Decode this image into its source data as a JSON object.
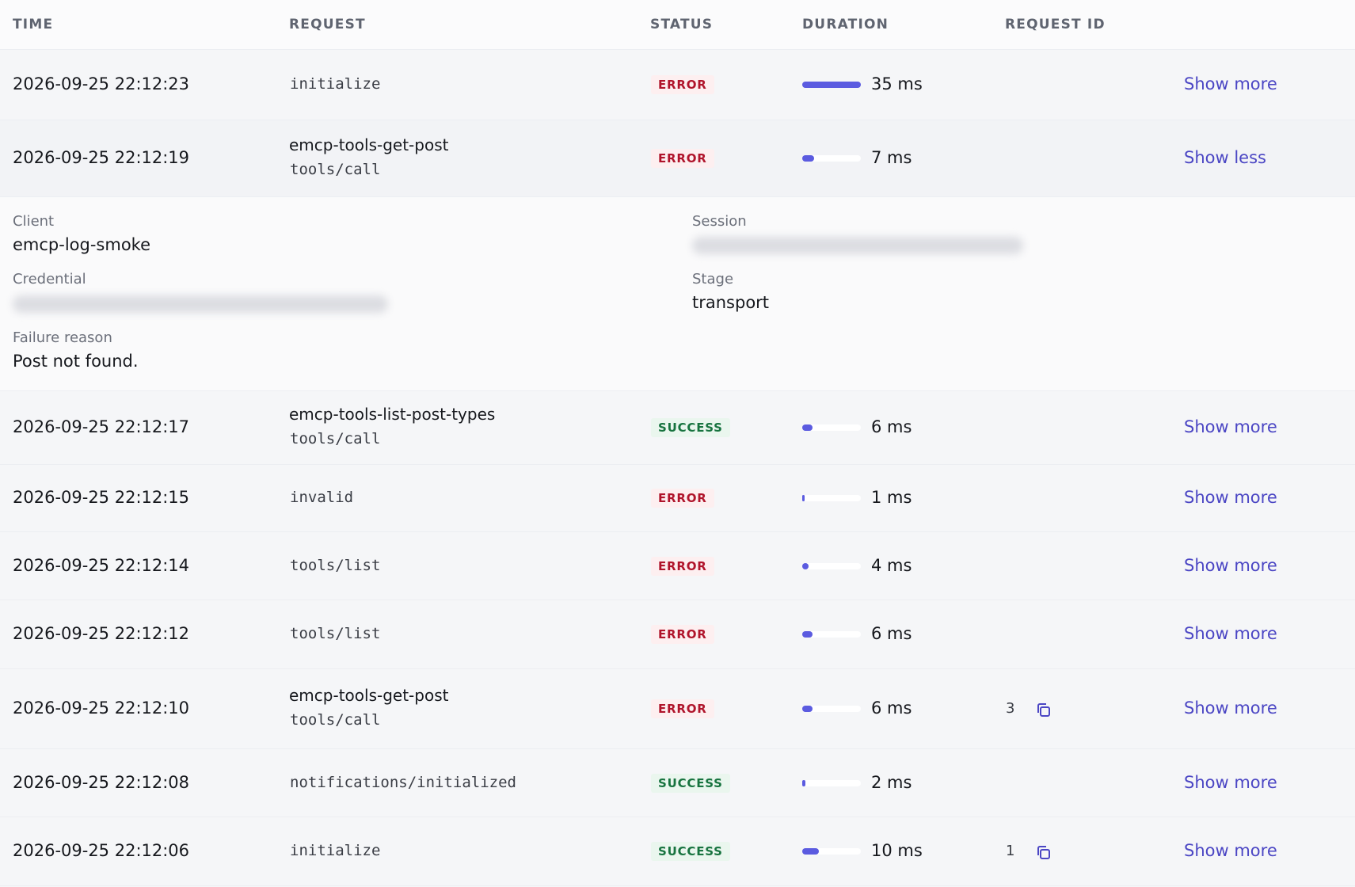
{
  "columns": {
    "time": "TIME",
    "request": "REQUEST",
    "status": "STATUS",
    "duration": "DURATION",
    "request_id": "REQUEST ID"
  },
  "colors": {
    "accent": "#5b5be0",
    "link": "#4b46c4",
    "error": "#b0142b",
    "success": "#17733f"
  },
  "rows": [
    {
      "time": "2026-09-25 22:12:23",
      "name": "",
      "method": "initialize",
      "status": "ERROR",
      "status_kind": "error",
      "duration_ms": 35,
      "duration_label": "35 ms",
      "request_id": "",
      "toggle": "Show more"
    },
    {
      "time": "2026-09-25 22:12:19",
      "name": "emcp-tools-get-post",
      "method": "tools/call",
      "status": "ERROR",
      "status_kind": "error",
      "duration_ms": 7,
      "duration_label": "7 ms",
      "request_id": "",
      "toggle": "Show less"
    },
    {
      "time": "2026-09-25 22:12:17",
      "name": "emcp-tools-list-post-types",
      "method": "tools/call",
      "status": "SUCCESS",
      "status_kind": "success",
      "duration_ms": 6,
      "duration_label": "6 ms",
      "request_id": "",
      "toggle": "Show more"
    },
    {
      "time": "2026-09-25 22:12:15",
      "name": "",
      "method": "invalid",
      "status": "ERROR",
      "status_kind": "error",
      "duration_ms": 1,
      "duration_label": "1 ms",
      "request_id": "",
      "toggle": "Show more"
    },
    {
      "time": "2026-09-25 22:12:14",
      "name": "",
      "method": "tools/list",
      "status": "ERROR",
      "status_kind": "error",
      "duration_ms": 4,
      "duration_label": "4 ms",
      "request_id": "",
      "toggle": "Show more"
    },
    {
      "time": "2026-09-25 22:12:12",
      "name": "",
      "method": "tools/list",
      "status": "ERROR",
      "status_kind": "error",
      "duration_ms": 6,
      "duration_label": "6 ms",
      "request_id": "",
      "toggle": "Show more"
    },
    {
      "time": "2026-09-25 22:12:10",
      "name": "emcp-tools-get-post",
      "method": "tools/call",
      "status": "ERROR",
      "status_kind": "error",
      "duration_ms": 6,
      "duration_label": "6 ms",
      "request_id": "3",
      "toggle": "Show more"
    },
    {
      "time": "2026-09-25 22:12:08",
      "name": "",
      "method": "notifications/initialized",
      "status": "SUCCESS",
      "status_kind": "success",
      "duration_ms": 2,
      "duration_label": "2 ms",
      "request_id": "",
      "toggle": "Show more"
    },
    {
      "time": "2026-09-25 22:12:06",
      "name": "",
      "method": "initialize",
      "status": "SUCCESS",
      "status_kind": "success",
      "duration_ms": 10,
      "duration_label": "10 ms",
      "request_id": "1",
      "toggle": "Show more"
    }
  ],
  "details": {
    "client_label": "Client",
    "client_value": "emcp-log-smoke",
    "credential_label": "Credential",
    "failure_label": "Failure reason",
    "failure_value": "Post not found.",
    "session_label": "Session",
    "stage_label": "Stage",
    "stage_value": "transport"
  },
  "icons": {
    "copy": "copy-icon"
  }
}
